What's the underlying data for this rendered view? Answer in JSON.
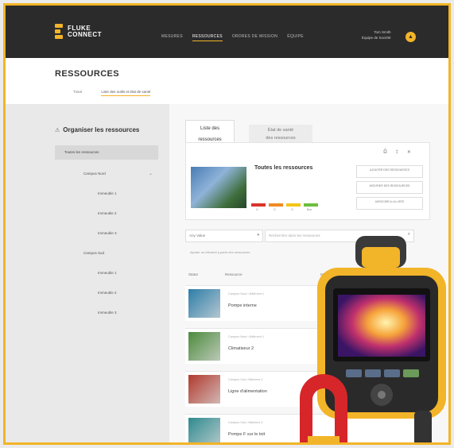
{
  "brand": {
    "line1": "FLUKE",
    "line2": "CONNECT"
  },
  "nav": {
    "items": [
      "MESURES",
      "RESSOURCES",
      "ORDRES DE MISSION",
      "ÉQUIPE"
    ],
    "active_index": 1
  },
  "user": {
    "line1": "Tom Smith",
    "line2": "Équipe de Société",
    "badge_glyph": "▲"
  },
  "page": {
    "title": "RESSOURCES",
    "breadcrumbs": [
      "Tracé",
      "Liste des outils et état de santé"
    ]
  },
  "sidebar": {
    "heading": "Organiser les ressources",
    "all": "Toutes les ressources",
    "items": [
      {
        "label": "Campus Nord",
        "level": 1
      },
      {
        "label": "Immeuble 1",
        "level": 2
      },
      {
        "label": "Immeuble 2",
        "level": 2
      },
      {
        "label": "Immeuble 3",
        "level": 2
      },
      {
        "label": "Campus Sud",
        "level": 1
      },
      {
        "label": "Immeuble 1",
        "level": 2
      },
      {
        "label": "Immeuble 2",
        "level": 2
      },
      {
        "label": "Immeuble 3",
        "level": 2
      }
    ]
  },
  "tabs": [
    {
      "line1": "Liste des",
      "line2": "ressources"
    },
    {
      "line1": "État de santé",
      "line2": "des ressources"
    }
  ],
  "summary": {
    "title": "Toutes les ressources",
    "health_bars": [
      {
        "color": "#d9342b",
        "label": "O"
      },
      {
        "color": "#f08a24",
        "label": "O"
      },
      {
        "color": "#f5c518",
        "label": "O"
      },
      {
        "color": "#6cbf3e",
        "label": "Bon"
      }
    ],
    "action_buttons": [
      "AJOUTER DES RESSOURCES",
      "MODIFIER DES RESSOURCES",
      "ASSOCIER A LA LISTE"
    ]
  },
  "filters": {
    "select_value": "Any Value",
    "search_placeholder": "Rechercher dans les ressources",
    "hint": "Ajouter un élément à partir des ressources"
  },
  "columns": [
    "Statut",
    "Ressource",
    "Mesure"
  ],
  "rows": [
    {
      "meta": "Campus Nord • Bâtiment 1",
      "name": "Pompe interne",
      "thumb_color": "#2d7da8"
    },
    {
      "meta": "Campus Nord • Bâtiment 1",
      "name": "Climatiseur 2",
      "thumb_color": "#4d8a3d"
    },
    {
      "meta": "Campus Sud • Bâtiment 2",
      "name": "Ligne d'alimentation",
      "thumb_color": "#b03a2e"
    },
    {
      "meta": "Campus Sud • Bâtiment 4",
      "name": "Pompe F sur le toit",
      "thumb_color": "#2f8a8f"
    }
  ],
  "colors": {
    "accent": "#f2b428",
    "header_bg": "#2b2b2b"
  }
}
